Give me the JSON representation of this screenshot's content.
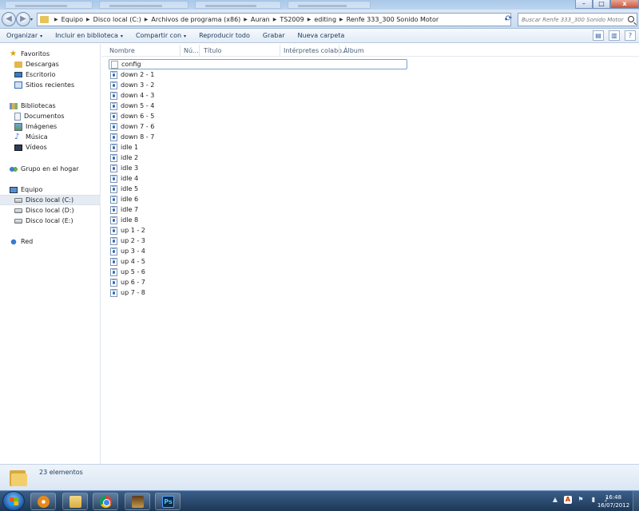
{
  "window": {
    "minimize_glyph": "–",
    "maximize_glyph": "□",
    "close_glyph": "x"
  },
  "address_bar": {
    "breadcrumbs": [
      "Equipo",
      "Disco local (C:)",
      "Archivos de programa (x86)",
      "Auran",
      "TS2009",
      "editing",
      "Renfe 333_300 Sonido Motor"
    ],
    "search_placeholder": "Buscar Renfe 333_300 Sonido Motor",
    "back_glyph": "◀",
    "forward_glyph": "▶",
    "refresh_glyph": "⟳"
  },
  "toolbar": {
    "items": [
      {
        "label": "Organizar",
        "has_menu": true
      },
      {
        "label": "Incluir en biblioteca",
        "has_menu": true
      },
      {
        "label": "Compartir con",
        "has_menu": true
      },
      {
        "label": "Reproducir todo",
        "has_menu": false
      },
      {
        "label": "Grabar",
        "has_menu": false
      },
      {
        "label": "Nueva carpeta",
        "has_menu": false
      }
    ],
    "caret_glyph": "▾",
    "help_glyph": "?"
  },
  "sidebar": {
    "favorites": {
      "label": "Favoritos",
      "items": [
        "Descargas",
        "Escritorio",
        "Sitios recientes"
      ]
    },
    "libraries": {
      "label": "Bibliotecas",
      "items": [
        "Documentos",
        "Imágenes",
        "Música",
        "Vídeos"
      ]
    },
    "homegroup": {
      "label": "Grupo en el hogar"
    },
    "computer": {
      "label": "Equipo",
      "items": [
        "Disco local (C:)",
        "Disco local (D:)",
        "Disco local (E:)"
      ],
      "selected": "Disco local (C:)"
    },
    "network": {
      "label": "Red"
    }
  },
  "columns": [
    "Nombre",
    "Nú...",
    "Título",
    "Intérpretes colabo...",
    "Álbum"
  ],
  "files": [
    {
      "name": "config",
      "type": "text"
    },
    {
      "name": "down 2 - 1",
      "type": "audio"
    },
    {
      "name": "down 3 - 2",
      "type": "audio"
    },
    {
      "name": "down 4 - 3",
      "type": "audio"
    },
    {
      "name": "down 5 - 4",
      "type": "audio"
    },
    {
      "name": "down 6 - 5",
      "type": "audio"
    },
    {
      "name": "down 7 - 6",
      "type": "audio"
    },
    {
      "name": "down 8 - 7",
      "type": "audio"
    },
    {
      "name": "idle 1",
      "type": "audio"
    },
    {
      "name": "idle 2",
      "type": "audio"
    },
    {
      "name": "idle 3",
      "type": "audio"
    },
    {
      "name": "idle 4",
      "type": "audio"
    },
    {
      "name": "idle 5",
      "type": "audio"
    },
    {
      "name": "idle 6",
      "type": "audio"
    },
    {
      "name": "idle 7",
      "type": "audio"
    },
    {
      "name": "idle 8",
      "type": "audio"
    },
    {
      "name": "up 1 - 2",
      "type": "audio"
    },
    {
      "name": "up 2 - 3",
      "type": "audio"
    },
    {
      "name": "up 3 - 4",
      "type": "audio"
    },
    {
      "name": "up 4 - 5",
      "type": "audio"
    },
    {
      "name": "up 5 - 6",
      "type": "audio"
    },
    {
      "name": "up 6 - 7",
      "type": "audio"
    },
    {
      "name": "up 7 - 8",
      "type": "audio"
    }
  ],
  "status": {
    "count_text": "23 elementos"
  },
  "taskbar": {
    "apps": [
      "media-player-icon",
      "explorer-icon",
      "chrome-icon",
      "trainz-icon",
      "photoshop-icon"
    ],
    "ps_label": "Ps",
    "tray_acrobat": "A",
    "tray_glyphs": [
      "▲",
      "⚑",
      "▮",
      "♪"
    ],
    "time": "16:48",
    "date": "16/07/2012"
  }
}
